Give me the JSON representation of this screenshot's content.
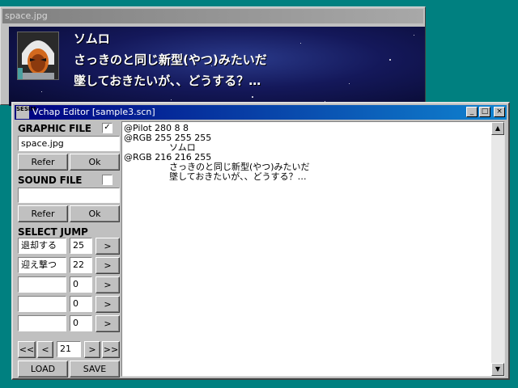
{
  "background_window": {
    "title": "space.jpg",
    "dialogue": {
      "speaker": "ソムロ",
      "line1": "さっきのと同じ新型(やつ)みたいだ",
      "line2": "墜しておきたいが、、どうする？…"
    }
  },
  "editor": {
    "title": "Vchap Editor [sample3.scn]",
    "app_icon": "SESIM",
    "window_controls": {
      "minimize": "_",
      "maximize": "□",
      "close": "×"
    },
    "graphic": {
      "header": "GRAPHIC FILE",
      "checked": true,
      "file": "space.jpg",
      "refer_label": "Refer",
      "ok_label": "Ok"
    },
    "sound": {
      "header": "SOUND FILE",
      "checked": false,
      "file": "",
      "refer_label": "Refer",
      "ok_label": "Ok"
    },
    "select_jump": {
      "header": "SELECT JUMP",
      "rows": [
        {
          "label": "退却する",
          "value": "25",
          "go": ">"
        },
        {
          "label": "迎え撃つ",
          "value": "22",
          "go": ">"
        },
        {
          "label": "",
          "value": "0",
          "go": ">"
        },
        {
          "label": "",
          "value": "0",
          "go": ">"
        },
        {
          "label": "",
          "value": "0",
          "go": ">"
        }
      ]
    },
    "navigation": {
      "first": "<<",
      "prev": "<",
      "page": "21",
      "next": ">",
      "last": ">>"
    },
    "load_label": "LOAD",
    "save_label": "SAVE",
    "script_lines": [
      "@Pilot 280 8 8",
      "@RGB 255 255 255",
      "                ソムロ",
      "@RGB 216 216 255",
      "                さっきのと同じ新型(やつ)みたいだ",
      "                墜しておきたいが、、どうする？…"
    ]
  }
}
